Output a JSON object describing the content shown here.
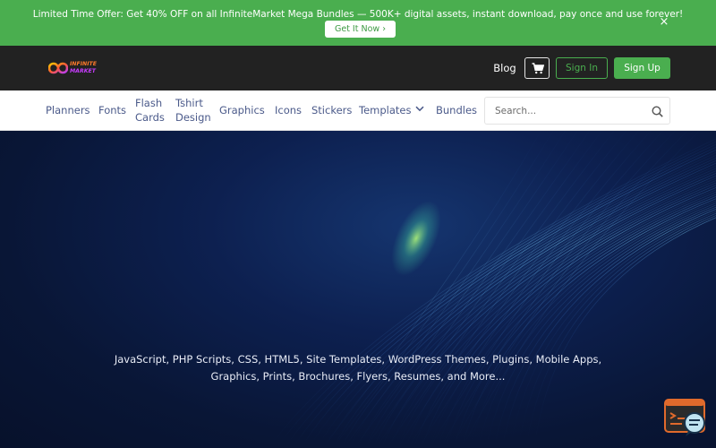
{
  "promo": {
    "text": "Limited Time Offer: Get 40% OFF on all InfiniteMarket Mega Bundles — 500K+ digital assets, instant download, pay once and use forever!",
    "button_label": "Get It Now ›",
    "close_label": "×"
  },
  "header": {
    "logo_line1": "INFINITE",
    "logo_line2": "MARKET",
    "blog_label": "Blog",
    "cart_icon": "shopping-cart-icon",
    "signin_label": "Sign In",
    "signup_label": "Sign Up"
  },
  "nav": {
    "items": [
      {
        "label": "Planners"
      },
      {
        "label": "Fonts"
      },
      {
        "label_line1": "Flash",
        "label_line2": "Cards"
      },
      {
        "label_line1": "Tshirt",
        "label_line2": "Design"
      },
      {
        "label": "Graphics"
      },
      {
        "label": "Icons"
      },
      {
        "label": "Stickers"
      },
      {
        "label": "Templates",
        "icon": "chevron-down-icon"
      },
      {
        "label": "Bundles"
      }
    ],
    "search": {
      "placeholder": "Search...",
      "icon": "search-icon"
    }
  },
  "hero": {
    "line1": "JavaScript, PHP Scripts, CSS, HTML5, Site Templates, WordPress Themes, Plugins, Mobile Apps,",
    "line2": "Graphics, Prints, Brochures, Flyers, Resumes, and More..."
  },
  "chat": {
    "icon": "chat-support-icon"
  },
  "colors": {
    "brand_green": "#4aae4f",
    "header_bg": "#222222",
    "nav_text": "#4b5a8a",
    "hero_bg": "#0b1a3d"
  }
}
